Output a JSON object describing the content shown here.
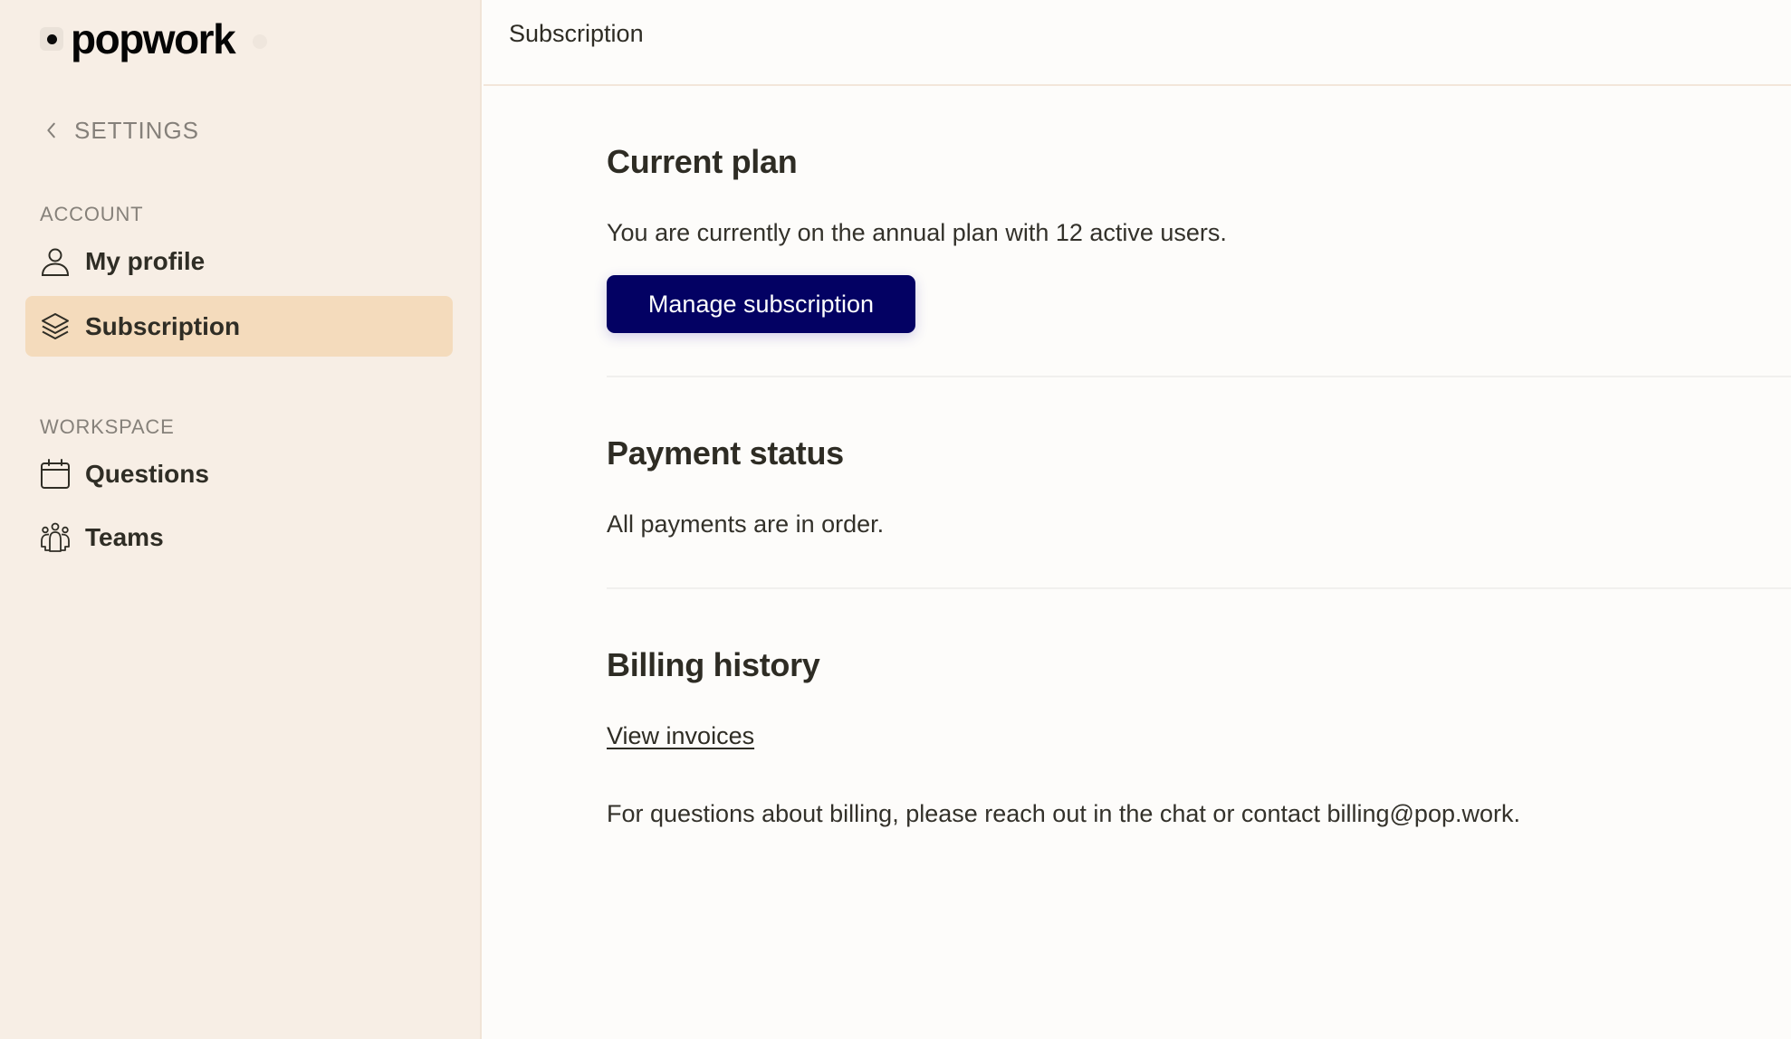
{
  "brand": {
    "name": "popwork"
  },
  "sidebar": {
    "back_label": "SETTINGS",
    "sections": [
      {
        "label": "ACCOUNT",
        "items": [
          {
            "label": "My profile",
            "icon": "user-icon",
            "active": false
          },
          {
            "label": "Subscription",
            "icon": "layers-icon",
            "active": true
          }
        ]
      },
      {
        "label": "WORKSPACE",
        "items": [
          {
            "label": "Questions",
            "icon": "calendar-icon",
            "active": false
          },
          {
            "label": "Teams",
            "icon": "team-icon",
            "active": false
          }
        ]
      }
    ]
  },
  "header": {
    "title": "Subscription"
  },
  "main": {
    "current_plan": {
      "title": "Current plan",
      "description": "You are currently on the annual plan with 12 active users.",
      "button_label": "Manage subscription"
    },
    "payment_status": {
      "title": "Payment status",
      "description": "All payments are in order."
    },
    "billing_history": {
      "title": "Billing history",
      "link_label": "View invoices",
      "note": "For questions about billing, please reach out in the chat or contact billing@pop.work."
    }
  },
  "colors": {
    "sidebar_bg": "#F7EEE5",
    "active_item_bg": "#F4DBBC",
    "primary_button": "#030163",
    "main_bg": "#FDFCFA"
  }
}
